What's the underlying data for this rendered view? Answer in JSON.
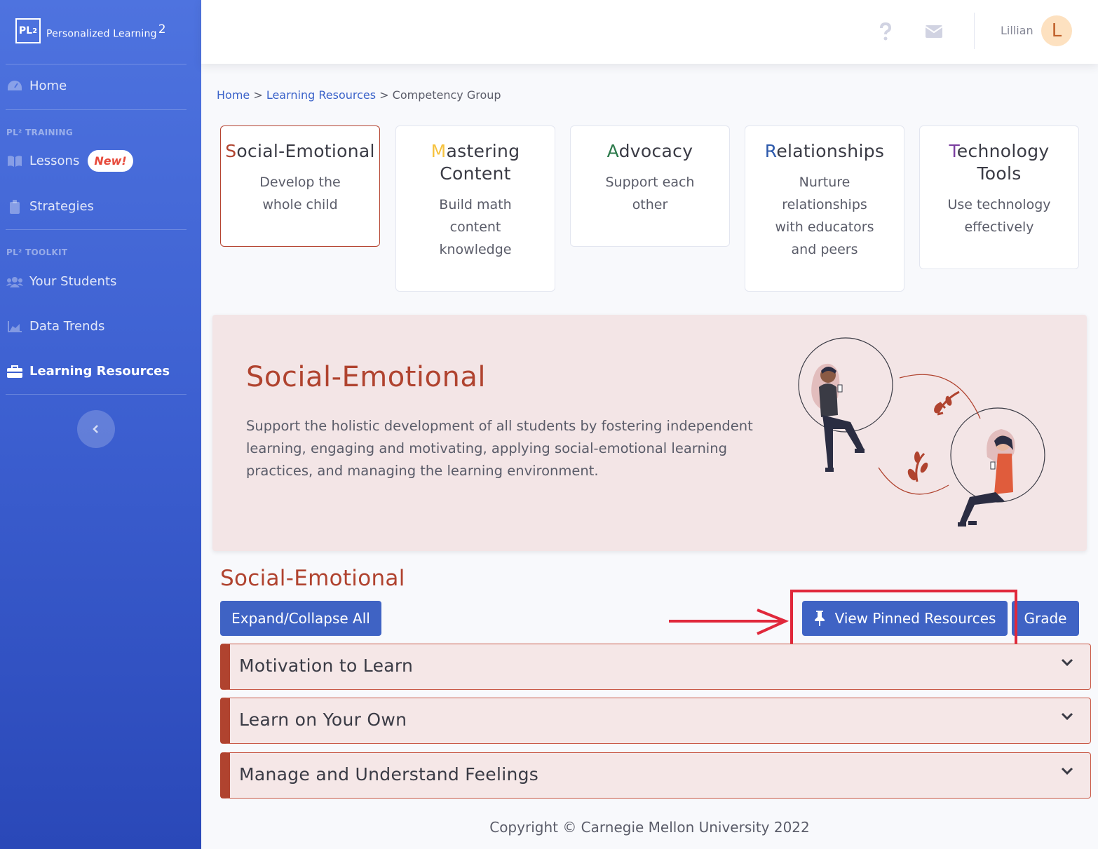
{
  "brand": {
    "logo": "PL",
    "logo_sup": "2",
    "name": "Personalized Learning",
    "name_sup": "2"
  },
  "sidebar": {
    "home": "Home",
    "training_heading": "PL² TRAINING",
    "lessons": "Lessons",
    "lessons_badge": "New!",
    "strategies": "Strategies",
    "toolkit_heading": "PL² TOOLKIT",
    "students": "Your Students",
    "trends": "Data Trends",
    "resources": "Learning Resources"
  },
  "topbar": {
    "user_name": "Lillian",
    "avatar_initial": "L",
    "help_icon": "question-icon",
    "mail_icon": "envelope-icon"
  },
  "breadcrumb": {
    "home": "Home",
    "sep1": " > ",
    "resources": "Learning Resources",
    "sep2": " > ",
    "current": "Competency Group"
  },
  "cards": [
    {
      "first": "S",
      "rest": "ocial-Emotional",
      "first_color": "#b0432f",
      "desc": "Develop the whole child"
    },
    {
      "first": "M",
      "rest": "astering Content",
      "first_color": "#f6c23e",
      "desc": "Build math content knowledge"
    },
    {
      "first": "A",
      "rest": "dvocacy",
      "first_color": "#2c7a4b",
      "desc": "Support each other"
    },
    {
      "first": "R",
      "rest": "elationships",
      "first_color": "#2e5aac",
      "desc": "Nurture relationships with educators and peers"
    },
    {
      "first": "T",
      "rest": "echnology Tools",
      "first_color": "#7b3fa0",
      "desc": "Use technology effectively"
    }
  ],
  "hero": {
    "title": "Social-Emotional",
    "description": "Support the holistic development of all students by fostering independent learning, engaging and motivating, applying social-emotional learning practices, and managing the learning environment."
  },
  "section": {
    "title": "Social-Emotional",
    "expand_label": "Expand/Collapse All",
    "pinned_label": "View Pinned Resources",
    "grade_label": "Grade"
  },
  "accordions": [
    {
      "label": "Motivation to Learn"
    },
    {
      "label": "Learn on Your Own"
    },
    {
      "label": "Manage and Understand Feelings"
    }
  ],
  "footer": {
    "copyright": "Copyright © Carnegie Mellon University 2022"
  },
  "colors": {
    "primary": "#4e73df",
    "accent": "#b0432f",
    "highlight": "#e0283b"
  }
}
